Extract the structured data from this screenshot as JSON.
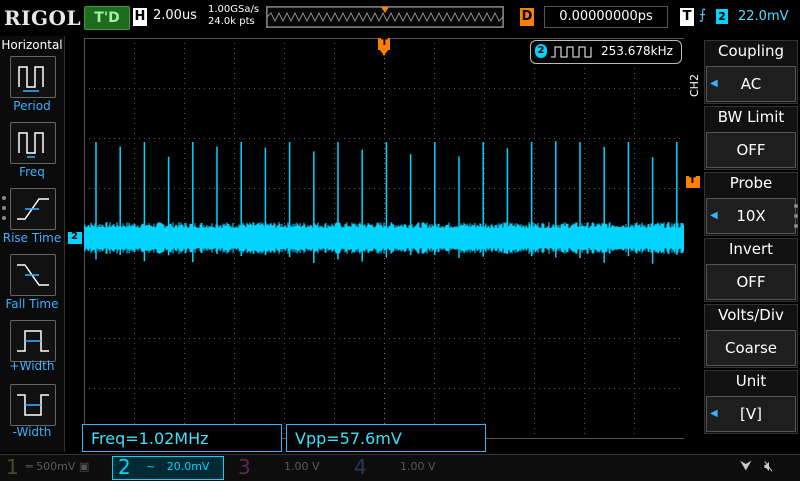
{
  "topbar": {
    "logo": "RIGOL",
    "trigger_status": "T'D",
    "horizontal_label": "H",
    "timebase": "2.00us",
    "sample_rate": "1.00GSa/s",
    "memory_depth": "24.0k pts",
    "delay_label": "D",
    "delay_value": "0.00000000ps",
    "trigger_label": "T",
    "trigger_source": "2",
    "trigger_level": "22.0mV"
  },
  "left_panel": {
    "title": "Horizontal",
    "items": [
      {
        "label": "Period",
        "icon": "period-icon"
      },
      {
        "label": "Freq",
        "icon": "frequency-icon"
      },
      {
        "label": "Rise Time",
        "icon": "rise-time-icon"
      },
      {
        "label": "Fall Time",
        "icon": "fall-time-icon"
      },
      {
        "label": "+Width",
        "icon": "positive-width-icon"
      },
      {
        "label": "-Width",
        "icon": "negative-width-icon"
      }
    ]
  },
  "screen": {
    "freq_counter_channel": "2",
    "freq_counter_value": "253.678kHz",
    "channel_marker": "2",
    "trigger_marker": "T",
    "trigger_level_marker": "T"
  },
  "right_panel": {
    "channel_tag": "CH2",
    "items": [
      {
        "title": "Coupling",
        "value": "AC",
        "has_arrow": true
      },
      {
        "title": "BW Limit",
        "value": "OFF",
        "has_arrow": false
      },
      {
        "title": "Probe",
        "value": "10X",
        "has_arrow": true
      },
      {
        "title": "Invert",
        "value": "OFF",
        "has_arrow": false
      },
      {
        "title": "Volts/Div",
        "value": "Coarse",
        "has_arrow": false
      },
      {
        "title": "Unit",
        "value": "[V]",
        "has_arrow": true
      }
    ]
  },
  "measurements": {
    "freq": "Freq=1.02MHz",
    "vpp": "Vpp=57.6mV"
  },
  "bottom_bar": {
    "channels": [
      {
        "num": "1",
        "scale": "500mV",
        "color": "#4a4a2a"
      },
      {
        "num": "2",
        "scale": "20.0mV",
        "color": "#00d4ff"
      },
      {
        "num": "3",
        "scale": "1.00 V",
        "color": "#5a2a4a"
      },
      {
        "num": "4",
        "scale": "1.00 V",
        "color": "#2a3a5a"
      }
    ]
  },
  "colors": {
    "ch2": "#00d4ff",
    "accent": "#3ab0ff",
    "trigger": "#ff7f00"
  }
}
